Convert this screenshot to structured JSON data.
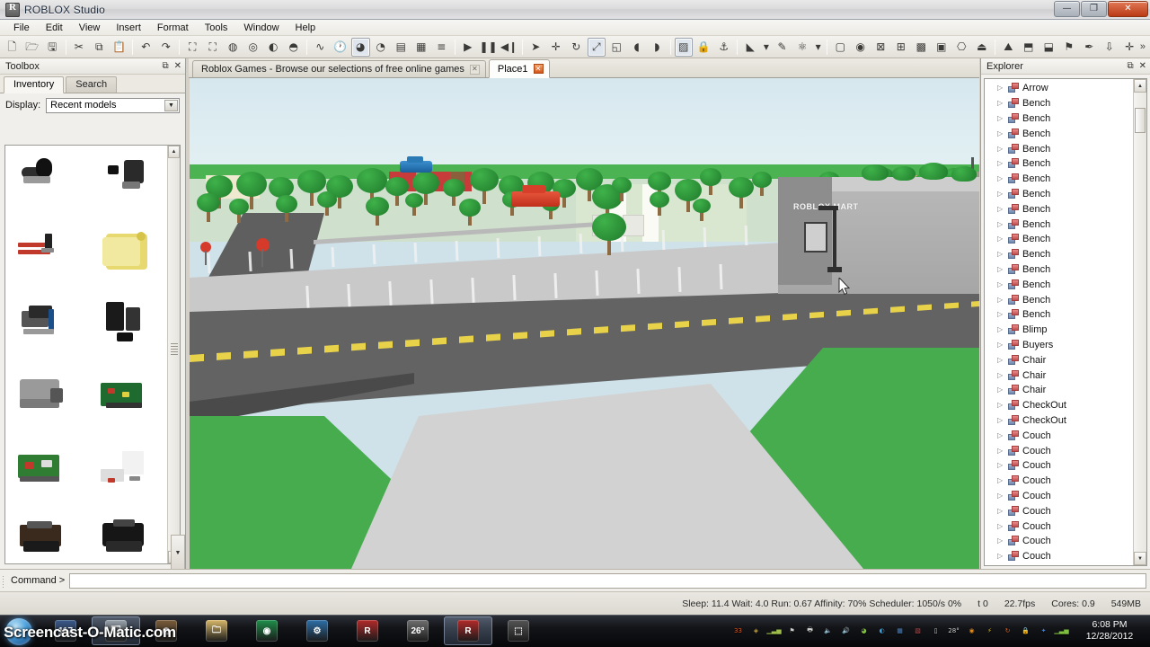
{
  "window": {
    "title": "ROBLOX Studio",
    "app_icon": "roblox-logo-icon",
    "minimize_glyph": "—",
    "maximize_glyph": "❐",
    "close_glyph": "✕"
  },
  "menubar": {
    "items": [
      "File",
      "Edit",
      "View",
      "Insert",
      "Format",
      "Tools",
      "Window",
      "Help"
    ]
  },
  "toolbar": {
    "overflow_glyph": "»",
    "groups": [
      {
        "buttons": [
          {
            "name": "new-file-icon",
            "glyph": "🗋"
          },
          {
            "name": "open-folder-icon",
            "glyph": "🗁"
          },
          {
            "name": "save-icon",
            "glyph": "🖫"
          }
        ]
      },
      {
        "buttons": [
          {
            "name": "cut-icon",
            "glyph": "✂"
          },
          {
            "name": "copy-icon",
            "glyph": "⧉"
          },
          {
            "name": "paste-icon",
            "glyph": "📋"
          }
        ]
      },
      {
        "buttons": [
          {
            "name": "undo-icon",
            "glyph": "↶"
          },
          {
            "name": "redo-icon",
            "glyph": "↷"
          }
        ]
      },
      {
        "buttons": [
          {
            "name": "group-icon",
            "glyph": "⛶"
          },
          {
            "name": "ungroup-icon",
            "glyph": "⛶"
          },
          {
            "name": "insert-object-icon",
            "glyph": "◍"
          },
          {
            "name": "insert-model-icon",
            "glyph": "◎"
          },
          {
            "name": "insert-part-add-icon",
            "glyph": "◐"
          },
          {
            "name": "insert-part-down-icon",
            "glyph": "◓"
          }
        ]
      },
      {
        "buttons": [
          {
            "name": "script-analysis-icon",
            "glyph": "∿"
          },
          {
            "name": "history-icon",
            "glyph": "🕐"
          },
          {
            "name": "game-explorer-icon",
            "glyph": "◕"
          },
          {
            "name": "add-service-icon",
            "glyph": "◔"
          },
          {
            "name": "object-browser-icon",
            "glyph": "▤"
          },
          {
            "name": "properties-icon",
            "glyph": "▦"
          },
          {
            "name": "output-icon",
            "glyph": "≡"
          }
        ]
      },
      {
        "buttons": [
          {
            "name": "play-icon",
            "glyph": "▶"
          },
          {
            "name": "pause-icon",
            "glyph": "❚❚"
          },
          {
            "name": "stop-step-icon",
            "glyph": "◀❙"
          }
        ]
      },
      {
        "buttons": [
          {
            "name": "select-tool-icon",
            "glyph": "➤"
          },
          {
            "name": "move-tool-icon",
            "glyph": "✛"
          },
          {
            "name": "rotate-tool-icon",
            "glyph": "↻"
          },
          {
            "name": "scale-tool-icon",
            "glyph": "⤢"
          },
          {
            "name": "material-tool-icon",
            "glyph": "◱"
          },
          {
            "name": "paint-add-icon",
            "glyph": "◖"
          },
          {
            "name": "paint-remove-icon",
            "glyph": "◗"
          }
        ]
      },
      {
        "buttons": [
          {
            "name": "surface-tool-icon",
            "glyph": "▨"
          },
          {
            "name": "lock-icon",
            "glyph": "🔒"
          },
          {
            "name": "anchor-icon",
            "glyph": "⚓"
          }
        ]
      },
      {
        "buttons": [
          {
            "name": "fill-color-icon",
            "glyph": "◣"
          },
          {
            "name": "fill-color-dropdown-icon",
            "glyph": "▾"
          },
          {
            "name": "eyedropper-icon",
            "glyph": "✎"
          },
          {
            "name": "material-picker-icon",
            "glyph": "⚛"
          },
          {
            "name": "material-dropdown-icon",
            "glyph": "▾"
          }
        ]
      },
      {
        "buttons": [
          {
            "name": "part-block-icon",
            "glyph": "▢"
          },
          {
            "name": "part-cylinder-icon",
            "glyph": "◉"
          },
          {
            "name": "part-wedge-icon",
            "glyph": "⊠"
          },
          {
            "name": "grid-small-icon",
            "glyph": "⊞"
          },
          {
            "name": "grid-medium-icon",
            "glyph": "▩"
          },
          {
            "name": "grid-large-icon",
            "glyph": "▣"
          },
          {
            "name": "stamp-icon",
            "glyph": "⎔"
          },
          {
            "name": "stamp-fill-icon",
            "glyph": "⏏"
          }
        ]
      },
      {
        "buttons": [
          {
            "name": "terrain-add-icon",
            "glyph": "⛰"
          },
          {
            "name": "terrain-grow-icon",
            "glyph": "⬒"
          },
          {
            "name": "terrain-erase-icon",
            "glyph": "⬓"
          },
          {
            "name": "terrain-flag-icon",
            "glyph": "⚑"
          },
          {
            "name": "terrain-paint-icon",
            "glyph": "✒"
          },
          {
            "name": "terrain-lower-icon",
            "glyph": "⇩"
          },
          {
            "name": "terrain-grid-icon",
            "glyph": "✛"
          }
        ]
      }
    ]
  },
  "toolbox": {
    "panel_title": "Toolbox",
    "float_glyph": "⧉",
    "close_glyph": "✕",
    "tabs": [
      {
        "label": "Inventory",
        "active": true
      },
      {
        "label": "Search",
        "active": false
      }
    ],
    "display_label": "Display:",
    "display_value": "Recent models",
    "dropdown_glyph": "▼",
    "scroll_up_glyph": "▲",
    "scroll_down_glyph": "▼",
    "items": [
      {
        "name": "thumbnail-magnet-model"
      },
      {
        "name": "thumbnail-clip-model"
      },
      {
        "name": "thumbnail-knife-model"
      },
      {
        "name": "thumbnail-scroll-model"
      },
      {
        "name": "thumbnail-book-model"
      },
      {
        "name": "thumbnail-phone-model"
      },
      {
        "name": "thumbnail-couch-model"
      },
      {
        "name": "thumbnail-circuit-model"
      },
      {
        "name": "thumbnail-table-model"
      },
      {
        "name": "thumbnail-papers-model"
      },
      {
        "name": "thumbnail-bench-model"
      },
      {
        "name": "thumbnail-sofa-model"
      }
    ]
  },
  "document_tabs": [
    {
      "label": "Roblox Games - Browse our selections of free online games",
      "active": false,
      "close_glyph": "✕"
    },
    {
      "label": "Place1",
      "active": true,
      "close_glyph": "✕"
    }
  ],
  "viewport": {
    "name": "3d-viewport",
    "scene_description": "Roblox town scene: parking lot, street with yellow center line, gray store building, trees, green lawns",
    "store_sign_text": "ROBLOX MART",
    "cursor": "arrow-cursor",
    "scroll_down_glyph": "▼",
    "colors": {
      "sky": "#d8e9ef",
      "grass": "#46ac4e",
      "road": "#636363",
      "road_line": "#e8d24a",
      "lot": "#c9c9c9",
      "building": "#b0b0b0",
      "tree_canopy": "#2a8d36",
      "car_blue": "#1f73b5",
      "car_red": "#d6402b"
    }
  },
  "explorer": {
    "panel_title": "Explorer",
    "float_glyph": "⧉",
    "close_glyph": "✕",
    "expand_glyph": "▷",
    "scroll_up_glyph": "▲",
    "scroll_down_glyph": "▼",
    "items": [
      "Arrow",
      "Bench",
      "Bench",
      "Bench",
      "Bench",
      "Bench",
      "Bench",
      "Bench",
      "Bench",
      "Bench",
      "Bench",
      "Bench",
      "Bench",
      "Bench",
      "Bench",
      "Bench",
      "Blimp",
      "Buyers",
      "Chair",
      "Chair",
      "Chair",
      "CheckOut",
      "CheckOut",
      "Couch",
      "Couch",
      "Couch",
      "Couch",
      "Couch",
      "Couch",
      "Couch",
      "Couch",
      "Couch"
    ]
  },
  "command_bar": {
    "label": "Command >",
    "value": "",
    "placeholder": ""
  },
  "status_bar": {
    "perf": "Sleep: 11.4 Wait: 4.0 Run: 0.67 Affinity: 70% Scheduler: 1050/s 0%",
    "t_value": "t 0",
    "fps": "22.7fps",
    "cores": "Cores: 0.9",
    "memory": "549MB"
  },
  "taskbar": {
    "start_button": "start-orb-icon",
    "watermark": "Screencast-O-Matic.com",
    "items": [
      {
        "name": "taskbar-item-screencast",
        "glyph": "117",
        "active": false
      },
      {
        "name": "taskbar-item-explorer-window",
        "glyph": "🗔",
        "active": true
      },
      {
        "name": "taskbar-item-media-player",
        "glyph": "◍",
        "active": false
      },
      {
        "name": "taskbar-item-file-explorer",
        "glyph": "🗀",
        "active": false
      },
      {
        "name": "taskbar-item-chrome",
        "glyph": "◉",
        "active": false
      },
      {
        "name": "taskbar-item-antivirus",
        "glyph": "⚙",
        "active": false
      },
      {
        "name": "taskbar-item-roblox-player",
        "glyph": "R",
        "active": false
      },
      {
        "name": "taskbar-item-weather",
        "glyph": "26°",
        "active": false
      },
      {
        "name": "taskbar-item-roblox-studio",
        "glyph": "R",
        "active": true
      },
      {
        "name": "taskbar-item-snipping-tool",
        "glyph": "⬚",
        "active": false
      }
    ],
    "tray_icons": [
      {
        "name": "tray-counter-icon",
        "glyph": "33"
      },
      {
        "name": "tray-shield-icon",
        "glyph": "◈"
      },
      {
        "name": "tray-network-icon",
        "glyph": "▁▃▅"
      },
      {
        "name": "tray-flag-icon",
        "glyph": "⚑"
      },
      {
        "name": "tray-printer-icon",
        "glyph": "🖶"
      },
      {
        "name": "tray-volume-mute-icon",
        "glyph": "🔈"
      },
      {
        "name": "tray-speaker-icon",
        "glyph": "🔊"
      },
      {
        "name": "tray-headset-icon",
        "glyph": "◕"
      },
      {
        "name": "tray-sync-icon",
        "glyph": "◐"
      },
      {
        "name": "tray-app-blue-icon",
        "glyph": "▦"
      },
      {
        "name": "tray-app-red-icon",
        "glyph": "▧"
      },
      {
        "name": "tray-battery-icon",
        "glyph": "▯"
      },
      {
        "name": "tray-weather-icon",
        "glyph": "28°"
      },
      {
        "name": "tray-orange-icon",
        "glyph": "◉"
      },
      {
        "name": "tray-lightning-icon",
        "glyph": "⚡"
      },
      {
        "name": "tray-update-icon",
        "glyph": "↻"
      },
      {
        "name": "tray-security-icon",
        "glyph": "🔒"
      },
      {
        "name": "tray-bluetooth-icon",
        "glyph": "✦"
      },
      {
        "name": "tray-signal-icon",
        "glyph": "▁▃▅"
      }
    ],
    "clock_time": "6:08 PM",
    "clock_date": "12/28/2012"
  }
}
